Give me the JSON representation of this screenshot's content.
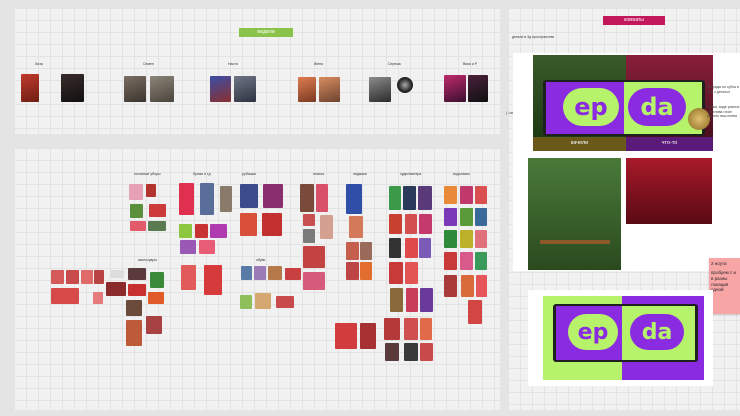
{
  "models": {
    "tag": "модели",
    "names": [
      "Лиза",
      "Семен",
      "Настя",
      "Женя",
      "Сережа",
      "Вика и Р"
    ]
  },
  "clothes": {
    "categories": [
      "головные уборы",
      "брюки и тд",
      "рубашки",
      "платья",
      "пиджаки",
      "худи/свитера",
      "водолазки",
      "аксессуары",
      "обувь"
    ]
  },
  "rooms": {
    "tag": "комнаты",
    "subtitle": "детали в 3д пространстве",
    "logo_left": "ep",
    "logo_right": "da",
    "caption_left": "качели",
    "caption_right": "что-то",
    "side_note": "Награды ил кубок в сам с детальн",
    "side_note2": "Гифки, виде разных перелива гиган патины наш пнева",
    "edge_label": "( ом )",
    "sticky_tag": "2 ноута",
    "sticky_text": "пробуем с и в разны локация одной"
  },
  "colors": {
    "green": "#8bc34a",
    "magenta": "#c2185b",
    "lime": "#b6f36a",
    "purple": "#8a2be2"
  }
}
